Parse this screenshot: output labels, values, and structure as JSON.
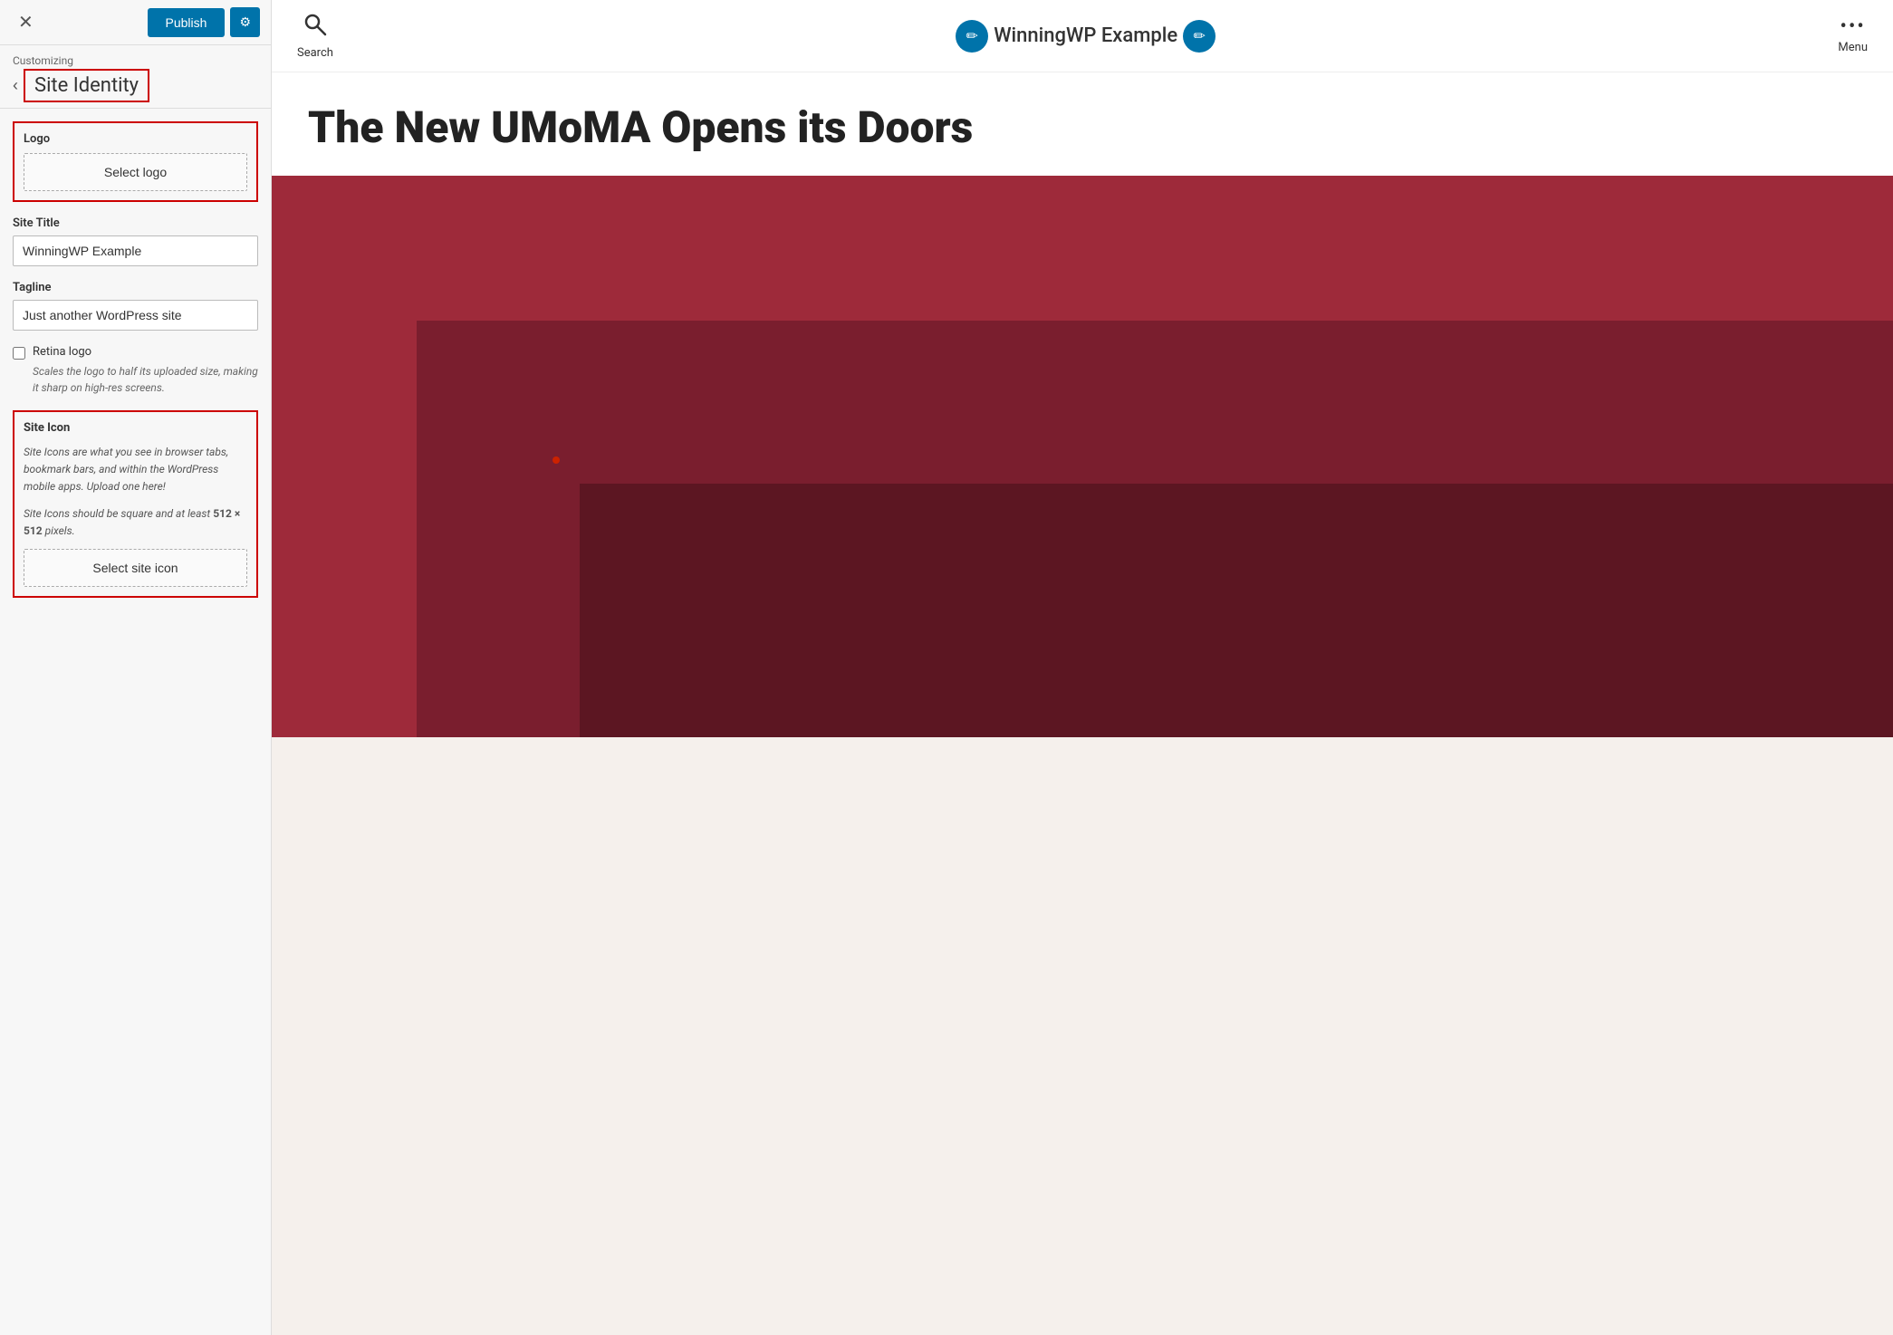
{
  "topbar": {
    "close_label": "✕",
    "publish_label": "Publish",
    "settings_icon": "⚙"
  },
  "customizing": {
    "label": "Customizing",
    "back_icon": "‹",
    "section_title": "Site Identity"
  },
  "logo_section": {
    "label": "Logo",
    "select_logo_label": "Select logo"
  },
  "site_title_field": {
    "label": "Site Title",
    "value": "WinningWP Example"
  },
  "tagline_field": {
    "label": "Tagline",
    "value": "Just another WordPress site"
  },
  "retina_logo": {
    "label": "Retina logo",
    "description": "Scales the logo to half its uploaded size, making it sharp on high-res screens."
  },
  "site_icon_section": {
    "label": "Site Icon",
    "description_1": "Site Icons are what you see in browser tabs, bookmark bars, and within the WordPress mobile apps. Upload one here!",
    "description_2_prefix": "Site Icons should be square and at least ",
    "description_2_bold": "512 × 512",
    "description_2_suffix": " pixels.",
    "select_icon_label": "Select site icon"
  },
  "preview": {
    "search_label": "Search",
    "brand_title": "WinningWP Example",
    "brand_icon": "✏",
    "menu_label": "Menu",
    "menu_dots": "•••",
    "hero_title": "The New UMoMA Opens its Doors"
  }
}
